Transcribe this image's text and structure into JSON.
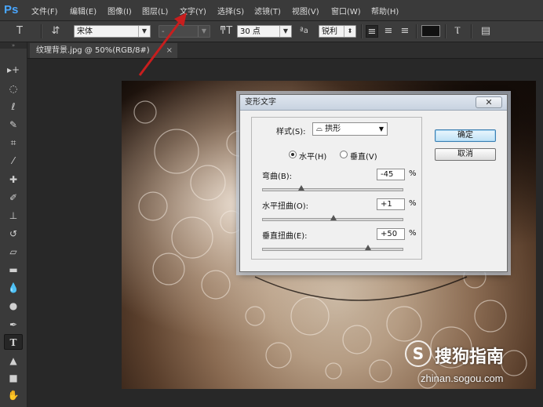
{
  "app": {
    "logo": "Ps"
  },
  "menu": [
    "文件(F)",
    "编辑(E)",
    "图像(I)",
    "图层(L)",
    "文字(Y)",
    "选择(S)",
    "滤镜(T)",
    "视图(V)",
    "窗口(W)",
    "帮助(H)"
  ],
  "options": {
    "font_family": "宋体",
    "font_style": "-",
    "font_size": "30 点",
    "aa_label": "ªa",
    "antialias": "锐利",
    "color_swatch": "#111111"
  },
  "document": {
    "tab_title": "纹理背景.jpg @ 50%(RGB/8#)",
    "close": "×"
  },
  "dialog": {
    "title": "变形文字",
    "close": "✕",
    "style_label": "样式(S):",
    "style_value": "拱形",
    "orientation": {
      "horizontal": "水平(H)",
      "vertical": "垂直(V)",
      "selected": "horizontal"
    },
    "bend": {
      "label": "弯曲(B):",
      "value": "-45",
      "unit": "%",
      "level": -45
    },
    "h_distort": {
      "label": "水平扭曲(O):",
      "value": "+1",
      "unit": "%",
      "level": 1
    },
    "v_distort": {
      "label": "垂直扭曲(E):",
      "value": "+50",
      "unit": "%",
      "level": 50
    },
    "ok": "确定",
    "cancel": "取消"
  },
  "watermark": {
    "logo": "S",
    "text": "搜狗指南",
    "url": "zhinan.sogou.com"
  },
  "colors": {
    "annotation_arrow": "#c81e1e",
    "accent": "#49a6ff"
  }
}
